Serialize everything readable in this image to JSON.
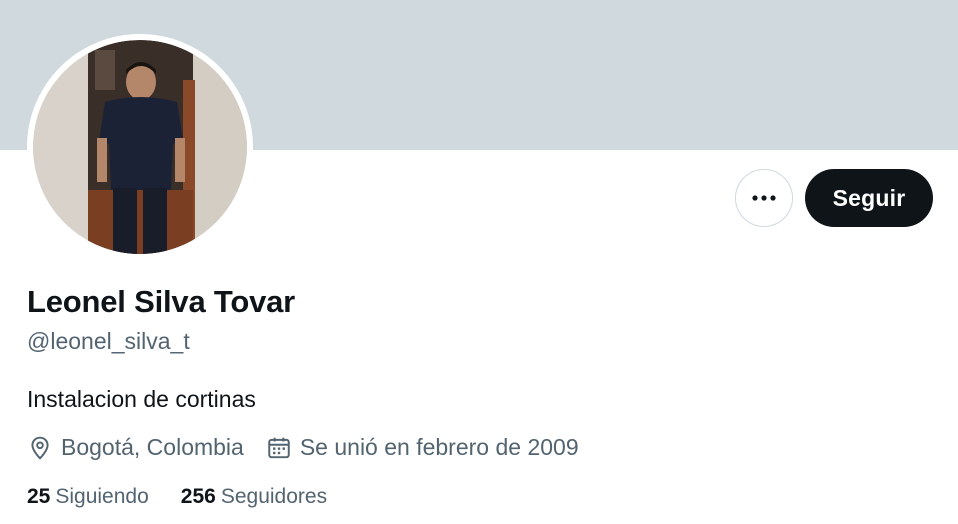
{
  "profile": {
    "name": "Leonel Silva Tovar",
    "handle": "@leonel_silva_t",
    "bio": "Instalacion de cortinas",
    "location": "Bogotá, Colombia",
    "joined": "Se unió en febrero de 2009",
    "following_count": "25",
    "following_label": "Siguiendo",
    "followers_count": "256",
    "followers_label": "Seguidores"
  },
  "actions": {
    "follow_label": "Seguir",
    "more_icon": "more-horizontal-icon"
  },
  "colors": {
    "banner": "#cfd9de",
    "primary_text": "#0f1419",
    "secondary_text": "#536471",
    "follow_button_bg": "#0f1419"
  }
}
